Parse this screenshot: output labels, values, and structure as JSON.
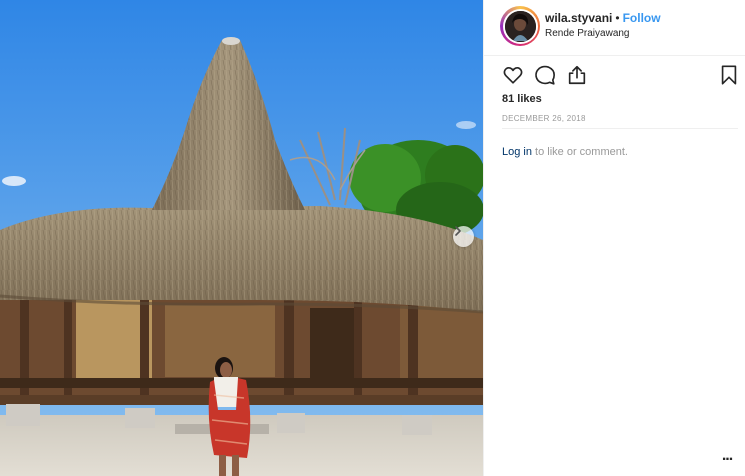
{
  "post": {
    "image_alt": "",
    "next_icon": "chevron-right-icon"
  },
  "header": {
    "username": "wila.styvani",
    "separator": "•",
    "follow_label": "Follow",
    "location": "Rende Praiyawang"
  },
  "actions": {
    "icons": [
      "heart-icon",
      "comment-icon",
      "share-icon",
      "bookmark-icon"
    ]
  },
  "likes": "81 likes",
  "date": "DECEMBER 26, 2018",
  "login": {
    "link_label": "Log in",
    "suffix": " to like or comment."
  },
  "more_label": "...",
  "colors": {
    "link_blue": "#3897f0",
    "text": "#262626",
    "muted": "#999999",
    "login_link": "#003569"
  }
}
